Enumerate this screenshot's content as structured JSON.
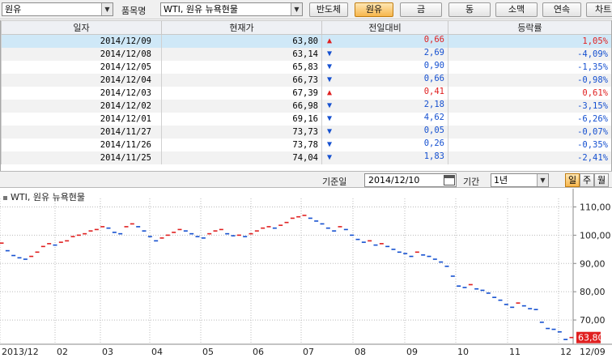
{
  "toolbar": {
    "category_value": "원유",
    "item_label": "품목명",
    "item_value": "WTI, 원유 뉴욕현물",
    "buttons": [
      "반도체",
      "원유",
      "금",
      "동",
      "소맥",
      "연속",
      "차트"
    ],
    "active_button": "원유"
  },
  "table": {
    "headers": [
      "일자",
      "현재가",
      "전일대비",
      "등락률"
    ],
    "rows": [
      {
        "date": "2014/12/09",
        "price": "63,80",
        "dir": "up",
        "change": "0,66",
        "rate": "1,05%"
      },
      {
        "date": "2014/12/08",
        "price": "63,14",
        "dir": "down",
        "change": "2,69",
        "rate": "-4,09%"
      },
      {
        "date": "2014/12/05",
        "price": "65,83",
        "dir": "down",
        "change": "0,90",
        "rate": "-1,35%"
      },
      {
        "date": "2014/12/04",
        "price": "66,73",
        "dir": "down",
        "change": "0,66",
        "rate": "-0,98%"
      },
      {
        "date": "2014/12/03",
        "price": "67,39",
        "dir": "up",
        "change": "0,41",
        "rate": "0,61%"
      },
      {
        "date": "2014/12/02",
        "price": "66,98",
        "dir": "down",
        "change": "2,18",
        "rate": "-3,15%"
      },
      {
        "date": "2014/12/01",
        "price": "69,16",
        "dir": "down",
        "change": "4,62",
        "rate": "-6,26%"
      },
      {
        "date": "2014/11/27",
        "price": "73,73",
        "dir": "down",
        "change": "0,05",
        "rate": "-0,07%"
      },
      {
        "date": "2014/11/26",
        "price": "73,78",
        "dir": "down",
        "change": "0,26",
        "rate": "-0,35%"
      },
      {
        "date": "2014/11/25",
        "price": "74,04",
        "dir": "down",
        "change": "1,83",
        "rate": "-2,41%"
      }
    ]
  },
  "controls": {
    "base_date_label": "기준일",
    "base_date_value": "2014/12/10",
    "period_label": "기간",
    "period_value": "1년",
    "period_buttons": [
      "일",
      "주",
      "월"
    ],
    "active_period": "일"
  },
  "chart_data": {
    "type": "line",
    "title": "WTI, 원유 뉴욕현물",
    "x_ticks": [
      "2013/12",
      "02",
      "03",
      "04",
      "05",
      "06",
      "07",
      "08",
      "09",
      "10",
      "11",
      "12",
      "12/09"
    ],
    "y_ticks": [
      "110,00",
      "100,00",
      "90,00",
      "80,00",
      "70,00"
    ],
    "ylim": [
      62,
      113
    ],
    "last_value_label": "63,80",
    "series": [
      {
        "values": [
          97.2,
          94.5,
          92.8,
          92.0,
          91.5,
          92.5,
          94.0,
          96.0,
          97.0,
          96.5,
          97.5,
          98.0,
          99.5,
          100.0,
          100.5,
          101.5,
          102.0,
          103.0,
          102.5,
          101.0,
          100.5,
          103.0,
          104.0,
          103.0,
          101.5,
          99.5,
          98.0,
          99.0,
          100.0,
          101.0,
          102.0,
          101.5,
          100.5,
          99.5,
          99.0,
          100.5,
          101.5,
          102.0,
          100.5,
          99.8,
          100.0,
          99.5,
          100.5,
          101.5,
          102.5,
          103.0,
          102.5,
          103.5,
          104.5,
          106.0,
          106.5,
          107.0,
          106.0,
          105.0,
          104.0,
          102.5,
          101.5,
          103.0,
          102.0,
          100.0,
          98.5,
          97.5,
          98.0,
          96.5,
          97.0,
          96.0,
          95.0,
          94.0,
          93.5,
          92.5,
          94.0,
          93.0,
          92.5,
          91.5,
          90.5,
          89.0,
          85.5,
          82.0,
          81.5,
          82.5,
          81.0,
          80.5,
          79.5,
          78.0,
          77.0,
          75.5,
          74.5,
          76.0,
          75.0,
          74.0,
          73.7,
          69.2,
          67.0,
          66.7,
          65.8,
          63.1,
          63.8
        ]
      }
    ]
  }
}
